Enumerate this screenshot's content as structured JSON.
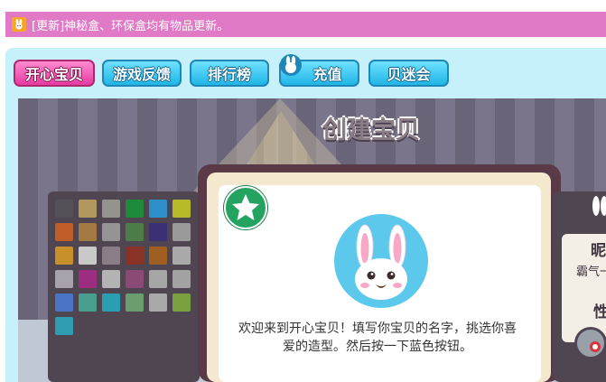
{
  "notice": {
    "text": "[更新]神秘盒、环保盒均有物品更新。",
    "icon": "bunny-icon",
    "background": "#e17ac6"
  },
  "nav": {
    "tabs": [
      {
        "label": "开心宝贝",
        "active": true
      },
      {
        "label": "游戏反馈",
        "active": false
      },
      {
        "label": "排行榜",
        "active": false
      },
      {
        "label": "充值",
        "active": false,
        "icon": "bunny-icon"
      },
      {
        "label": "贝迷会",
        "active": false
      }
    ]
  },
  "stage": {
    "title": "创建宝贝",
    "palette_colors": [
      "#545258",
      "#b0985e",
      "#94948e",
      "#1e8a3c",
      "#2f8fc9",
      "#b7bb2a",
      "#c05e29",
      "#a37a41",
      "#949494",
      "#4c7c48",
      "#3b2f78",
      "#9a9a9a",
      "#c8902a",
      "#c9c9c9",
      "#8a7d86",
      "#8b3226",
      "#a05f22",
      "#a9a9a9",
      "#a8a2ad",
      "#9c2d80",
      "#b3b3b3",
      "#8b4a76",
      "#a6a6a6",
      "#a2a2a2",
      "#4c74c6",
      "#4a9e8e",
      "#2a9fb1",
      "#6b9d6e",
      "#a9a9a9",
      "#7ba040",
      "#2f9db2"
    ]
  },
  "dialog": {
    "badge_icon": "star-icon",
    "avatar": "bunny-avatar",
    "message": "欢迎来到开心宝贝！填写你宝贝的名字，挑选你喜爱的造型。然后按一下蓝色按钮。"
  },
  "side": {
    "label_name": "昵",
    "label_sub": "霸气一",
    "label_gender": "性"
  }
}
